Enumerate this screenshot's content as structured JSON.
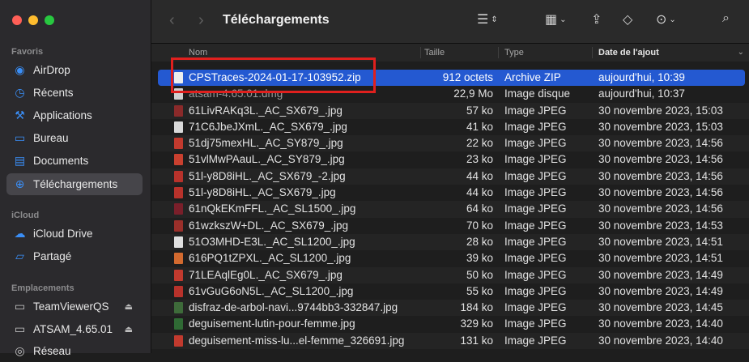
{
  "window": {
    "title": "Téléchargements"
  },
  "sidebar": {
    "favorites_title": "Favoris",
    "favorites": [
      {
        "label": "AirDrop",
        "icon": "airdrop-icon"
      },
      {
        "label": "Récents",
        "icon": "clock-icon"
      },
      {
        "label": "Applications",
        "icon": "applications-icon"
      },
      {
        "label": "Bureau",
        "icon": "desktop-icon"
      },
      {
        "label": "Documents",
        "icon": "document-icon"
      },
      {
        "label": "Téléchargements",
        "icon": "download-icon",
        "active": true
      }
    ],
    "icloud_title": "iCloud",
    "icloud": [
      {
        "label": "iCloud Drive",
        "icon": "cloud-icon"
      },
      {
        "label": "Partagé",
        "icon": "shared-folder-icon"
      }
    ],
    "locations_title": "Emplacements",
    "locations": [
      {
        "label": "TeamViewerQS",
        "icon": "drive-icon"
      },
      {
        "label": "ATSAM_4.65.01",
        "icon": "drive-icon"
      },
      {
        "label": "Réseau",
        "icon": "network-icon"
      }
    ]
  },
  "columns": {
    "name": "Nom",
    "size": "Taille",
    "kind": "Type",
    "date": "Date de l'ajout"
  },
  "files": [
    {
      "name": "CPSTraces-2024-01-17-103952.zip",
      "size": "912 octets",
      "kind": "Archive ZIP",
      "date": "aujourd'hui, 10:39"
    },
    {
      "name": "atsam-4.65.01.dmg",
      "size": "22,9 Mo",
      "kind": "Image disque",
      "date": "aujourd'hui, 10:37"
    },
    {
      "name": "61LivRAKq3L._AC_SX679_.jpg",
      "size": "57 ko",
      "kind": "Image JPEG",
      "date": "30 novembre 2023, 15:03"
    },
    {
      "name": "71C6JbeJXmL._AC_SX679_.jpg",
      "size": "41 ko",
      "kind": "Image JPEG",
      "date": "30 novembre 2023, 15:03"
    },
    {
      "name": "51dj75mexHL._AC_SY879_.jpg",
      "size": "22 ko",
      "kind": "Image JPEG",
      "date": "30 novembre 2023, 14:56"
    },
    {
      "name": "51vlMwPAauL._AC_SY879_.jpg",
      "size": "23 ko",
      "kind": "Image JPEG",
      "date": "30 novembre 2023, 14:56"
    },
    {
      "name": "51l-y8D8iHL._AC_SX679_-2.jpg",
      "size": "44 ko",
      "kind": "Image JPEG",
      "date": "30 novembre 2023, 14:56"
    },
    {
      "name": "51l-y8D8iHL._AC_SX679_.jpg",
      "size": "44 ko",
      "kind": "Image JPEG",
      "date": "30 novembre 2023, 14:56"
    },
    {
      "name": "61nQkEKmFFL._AC_SL1500_.jpg",
      "size": "64 ko",
      "kind": "Image JPEG",
      "date": "30 novembre 2023, 14:56"
    },
    {
      "name": "61wzkszW+DL._AC_SX679_.jpg",
      "size": "70 ko",
      "kind": "Image JPEG",
      "date": "30 novembre 2023, 14:53"
    },
    {
      "name": "51O3MHD-E3L._AC_SL1200_.jpg",
      "size": "28 ko",
      "kind": "Image JPEG",
      "date": "30 novembre 2023, 14:51"
    },
    {
      "name": "616PQ1tZPXL._AC_SL1200_.jpg",
      "size": "39 ko",
      "kind": "Image JPEG",
      "date": "30 novembre 2023, 14:51"
    },
    {
      "name": "71LEAqlEg0L._AC_SX679_.jpg",
      "size": "50 ko",
      "kind": "Image JPEG",
      "date": "30 novembre 2023, 14:49"
    },
    {
      "name": "61vGuG6oN5L._AC_SL1200_.jpg",
      "size": "55 ko",
      "kind": "Image JPEG",
      "date": "30 novembre 2023, 14:49"
    },
    {
      "name": "disfraz-de-arbol-navi...9744bb3-332847.jpg",
      "size": "184 ko",
      "kind": "Image JPEG",
      "date": "30 novembre 2023, 14:45"
    },
    {
      "name": "deguisement-lutin-pour-femme.jpg",
      "size": "329 ko",
      "kind": "Image JPEG",
      "date": "30 novembre 2023, 14:40"
    },
    {
      "name": "deguisement-miss-lu...el-femme_326691.jpg",
      "size": "131 ko",
      "kind": "Image JPEG",
      "date": "30 novembre 2023, 14:40"
    }
  ]
}
